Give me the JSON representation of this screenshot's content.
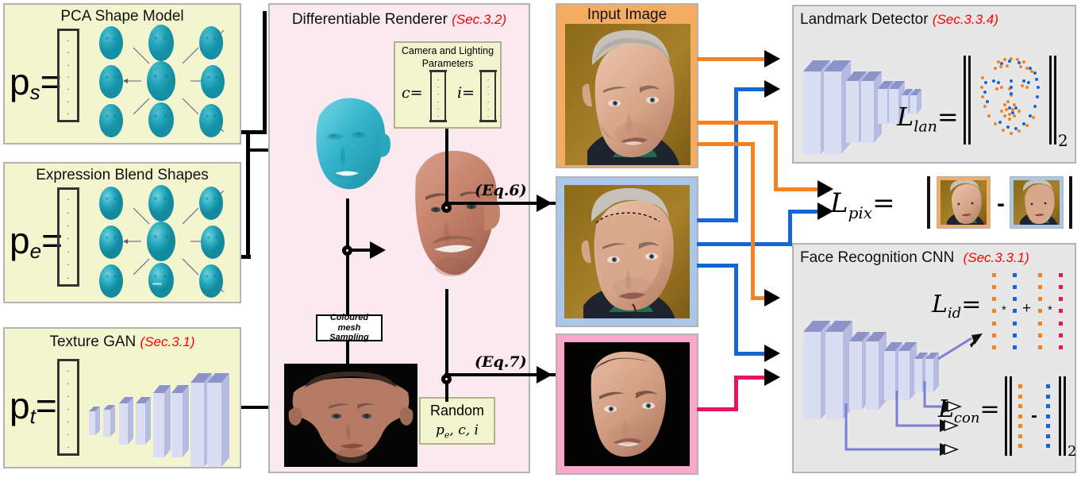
{
  "figure": {
    "domain": "method-pipeline-diagram",
    "colors": {
      "yellow_panel": "#f2f5ce",
      "pink_panel": "#fae9ef",
      "grey_panel": "#e7e7e7",
      "section_ref": "#ff0000",
      "orange_wire": "#f58220",
      "blue_wire": "#1565d8",
      "pink_wire": "#ec1164",
      "black_wire": "#000000",
      "teal_mesh": "#2aa7bf",
      "cnn_block": "#c6c8e8",
      "input_image_border": "#f4ac63",
      "render_image_border": "#aac6e8",
      "synth_image_border": "#f9a8c9"
    }
  },
  "panels": {
    "pca": {
      "title": "PCA Shape Model",
      "param_label": "p",
      "param_sub": "s",
      "equals": "="
    },
    "expression": {
      "title": "Expression Blend Shapes",
      "param_label": "p",
      "param_sub": "e",
      "equals": "="
    },
    "texture_gan": {
      "title": "Texture GAN",
      "section": "(Sec.3.1)",
      "param_label": "p",
      "param_sub": "t",
      "equals": "="
    },
    "renderer": {
      "title": "Differentiable Renderer",
      "section": "(Sec.3.2)",
      "camera_box": {
        "title_line1": "Camera and Lighting",
        "title_line2": "Parameters",
        "c_label": "c=",
        "i_label": "i="
      },
      "sampling_box": {
        "line1": "Coloured mesh",
        "line2": "Sampling"
      },
      "random_box": {
        "line1": "Random",
        "line2": "p_e, c, i",
        "line2_parts": [
          "p",
          "e",
          ", c, i"
        ]
      },
      "eq6": "(Eq.6)",
      "eq7": "(Eq.7)"
    },
    "input_image": {
      "title": "Input Image"
    },
    "landmark": {
      "title": "Landmark Detector",
      "section": "(Sec.3.3.4)",
      "loss": "L",
      "loss_sub": "lan",
      "equals": "=",
      "norm_sub": "2"
    },
    "pix": {
      "loss": "L",
      "loss_sub": "pix",
      "equals": "=",
      "minus": "-"
    },
    "face_recognition": {
      "title": "Face Recognition CNN",
      "section": "(Sec.3.3.1)",
      "id_loss": "L",
      "id_loss_sub": "id",
      "id_equals": "=",
      "id_mult1": "*",
      "id_plus": "+",
      "id_mult2": "*",
      "con_loss": "L",
      "con_loss_sub": "con",
      "con_equals": "=",
      "con_minus": "-",
      "con_norm_sub": "2"
    }
  },
  "vectors": {
    "dot": "."
  }
}
